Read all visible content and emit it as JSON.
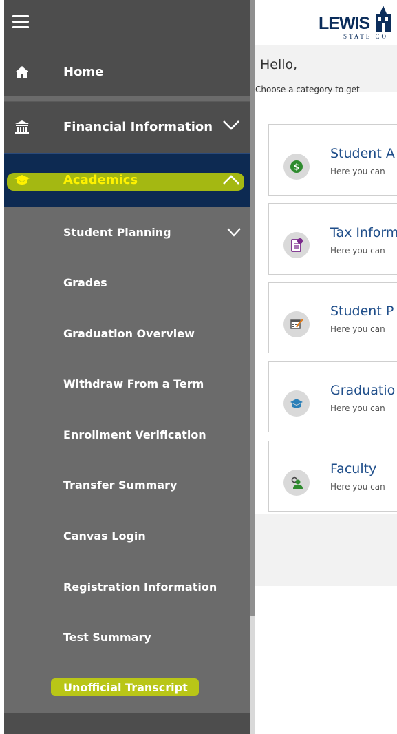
{
  "sidebar": {
    "top_items": [
      {
        "label": "Home",
        "icon": "home-icon"
      },
      {
        "label": "Financial Information",
        "icon": "bank-icon"
      },
      {
        "label": "Academics",
        "icon": "graduation-cap-icon"
      }
    ],
    "academics_sub_items": [
      {
        "label": "Student Planning"
      },
      {
        "label": "Grades"
      },
      {
        "label": "Graduation Overview"
      },
      {
        "label": "Withdraw From a Term"
      },
      {
        "label": "Enrollment Verification"
      },
      {
        "label": "Transfer Summary"
      },
      {
        "label": "Canvas Login"
      },
      {
        "label": "Registration Information"
      },
      {
        "label": "Test Summary"
      },
      {
        "label": "Unofficial Transcript"
      }
    ]
  },
  "header": {
    "logo_text": "LEWIS",
    "logo_subtext": "STATE CO"
  },
  "main": {
    "greeting": "Hello,",
    "subtitle": "Choose a category to get",
    "cards": [
      {
        "title": "Student A",
        "desc": "Here you can",
        "icon": "dollar-icon",
        "icon_color": "#2e8b2e"
      },
      {
        "title": "Tax Inform",
        "desc": "Here you can",
        "icon": "tax-form-icon",
        "icon_color": "#7a2a8c"
      },
      {
        "title": "Student P",
        "desc": "Here you can",
        "icon": "calendar-check-icon",
        "icon_color": "#e07b1a"
      },
      {
        "title": "Graduatio",
        "desc": "Here you can",
        "icon": "graduation-cap-icon",
        "icon_color": "#2a7fb8"
      },
      {
        "title": "Faculty",
        "desc": "Here you can",
        "icon": "faculty-icon",
        "icon_color": "#2e8b2e"
      }
    ]
  },
  "colors": {
    "sidebar_bg": "#6b6b6b",
    "sidebar_dark": "#4d4d4d",
    "academics_bg": "#0d2a52",
    "highlight": "#fff200",
    "card_title": "#1f4e8a"
  }
}
